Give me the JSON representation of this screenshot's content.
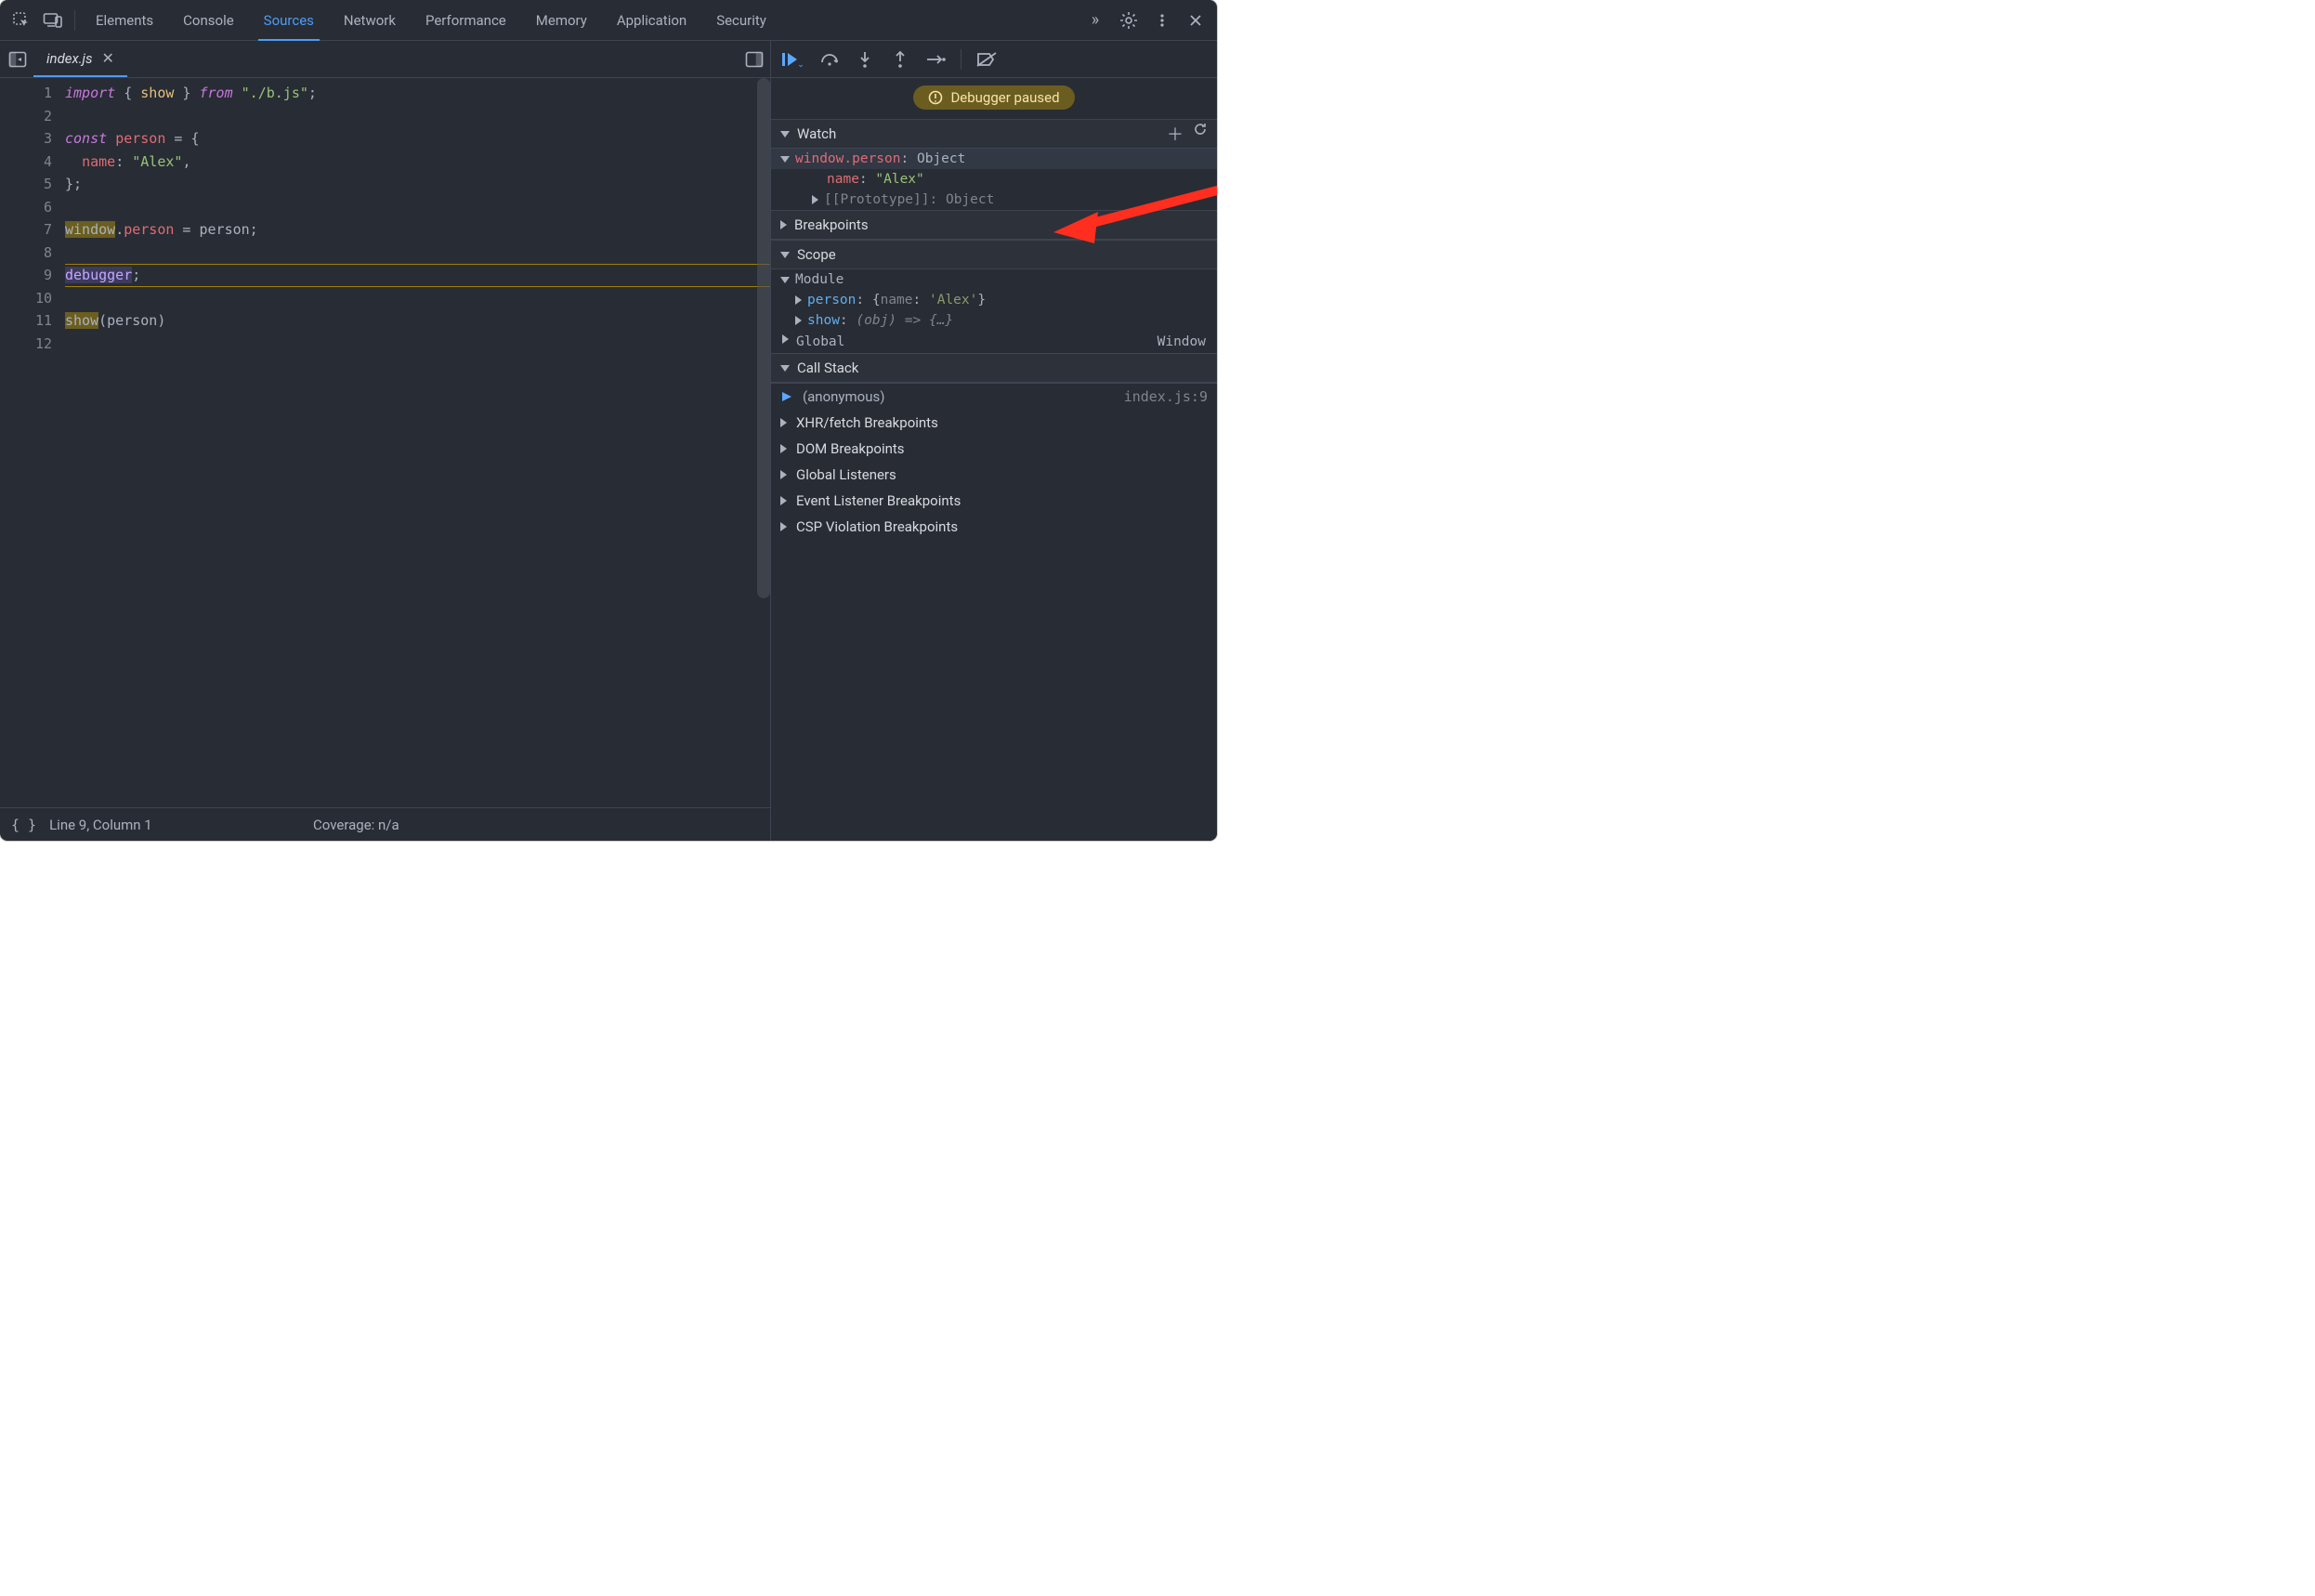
{
  "topTabs": [
    "Elements",
    "Console",
    "Sources",
    "Network",
    "Performance",
    "Memory",
    "Application",
    "Security"
  ],
  "activeTopTab": "Sources",
  "moreTabsGlyph": "»",
  "fileTab": {
    "name": "index.js",
    "close": "✕"
  },
  "code": {
    "lines": [
      {
        "n": 1,
        "frags": [
          [
            "kw",
            "import"
          ],
          [
            "",
            " { "
          ],
          [
            "fn",
            "show"
          ],
          [
            "",
            " } "
          ],
          [
            "kw",
            "from"
          ],
          [
            "",
            " "
          ],
          [
            "str",
            "\"./b.js\""
          ],
          [
            "",
            ";"
          ]
        ]
      },
      {
        "n": 2,
        "frags": []
      },
      {
        "n": 3,
        "frags": [
          [
            "kw",
            "const"
          ],
          [
            "",
            " "
          ],
          [
            "def",
            "person"
          ],
          [
            "",
            " = {"
          ]
        ]
      },
      {
        "n": 4,
        "frags": [
          [
            "",
            "  "
          ],
          [
            "def",
            "name"
          ],
          [
            "",
            ": "
          ],
          [
            "str",
            "\"Alex\""
          ],
          [
            "",
            ","
          ]
        ]
      },
      {
        "n": 5,
        "frags": [
          [
            "",
            "};"
          ]
        ]
      },
      {
        "n": 6,
        "frags": []
      },
      {
        "n": 7,
        "frags": [
          [
            "hl",
            "window"
          ],
          [
            "",
            "."
          ],
          [
            "def",
            "person"
          ],
          [
            "",
            " = "
          ],
          [
            "",
            "person;"
          ]
        ]
      },
      {
        "n": 8,
        "frags": []
      },
      {
        "n": 9,
        "exec": true,
        "frags": [
          [
            "dbg",
            "debugger"
          ],
          [
            "",
            ";"
          ]
        ]
      },
      {
        "n": 10,
        "frags": []
      },
      {
        "n": 11,
        "frags": [
          [
            "hl",
            "show"
          ],
          [
            "",
            "(person)"
          ]
        ]
      },
      {
        "n": 12,
        "frags": []
      }
    ]
  },
  "status": {
    "cursor": "Line 9, Column 1",
    "coverage": "Coverage: n/a"
  },
  "pauseBadge": "Debugger paused",
  "watch": {
    "title": "Watch",
    "entry": {
      "expr": "window.person",
      "summary": "Object",
      "children": [
        {
          "key": "name",
          "val": "\"Alex\"",
          "leaf": true
        },
        {
          "key": "[[Prototype]]",
          "val": "Object",
          "dim": true
        }
      ]
    }
  },
  "breakpointsTitle": "Breakpoints",
  "scope": {
    "title": "Scope",
    "module": {
      "label": "Module",
      "children": [
        {
          "key": "person",
          "inline": "{name: 'Alex'}"
        },
        {
          "key": "show",
          "inline": "(obj) => {…}",
          "italic": true
        }
      ]
    },
    "global": {
      "label": "Global",
      "value": "Window"
    }
  },
  "callstack": {
    "title": "Call Stack",
    "frames": [
      {
        "name": "(anonymous)",
        "loc": "index.js:9",
        "current": true
      }
    ]
  },
  "otherPanes": [
    "XHR/fetch Breakpoints",
    "DOM Breakpoints",
    "Global Listeners",
    "Event Listener Breakpoints",
    "CSP Violation Breakpoints"
  ]
}
